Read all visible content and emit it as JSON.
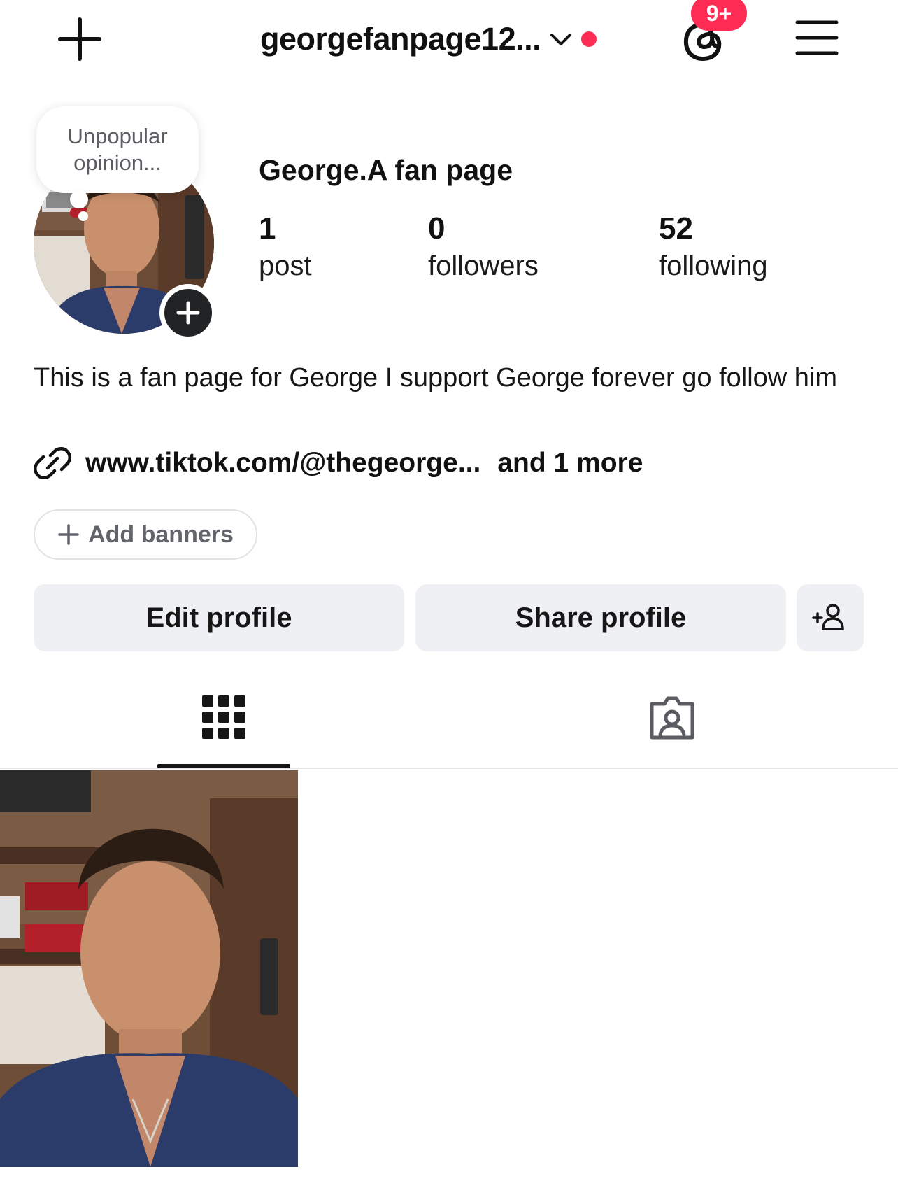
{
  "header": {
    "new_post_icon": "plus-icon",
    "username": "georgefanpage12...",
    "switch_account_icon": "chevron-down-icon",
    "threads_icon": "threads-icon",
    "threads_badge": "9+",
    "menu_icon": "hamburger-menu-icon",
    "accent_color": "#fe2c55"
  },
  "profile": {
    "note_bubble": "Unpopular opinion...",
    "display_name": "George.A fan page",
    "add_story_icon": "plus-icon",
    "stats": [
      {
        "value": "1",
        "label": "post"
      },
      {
        "value": "0",
        "label": "followers"
      },
      {
        "value": "52",
        "label": "following"
      }
    ]
  },
  "bio": {
    "text": "This is a fan page for George I support George forever go follow him",
    "link_icon": "link-icon",
    "link_text": "www.tiktok.com/@thegeorge...",
    "link_more": "and 1 more"
  },
  "banners": {
    "label": "Add banners"
  },
  "actions": {
    "edit_profile": "Edit profile",
    "share_profile": "Share profile",
    "discover_icon": "add-person-icon"
  },
  "tabs": [
    {
      "name": "posts",
      "icon": "grid-icon",
      "active": true
    },
    {
      "name": "tagged",
      "icon": "tagged-person-icon",
      "active": false
    }
  ],
  "grid": {
    "posts": [
      {
        "thumbnail": "selfie-photo"
      }
    ]
  }
}
